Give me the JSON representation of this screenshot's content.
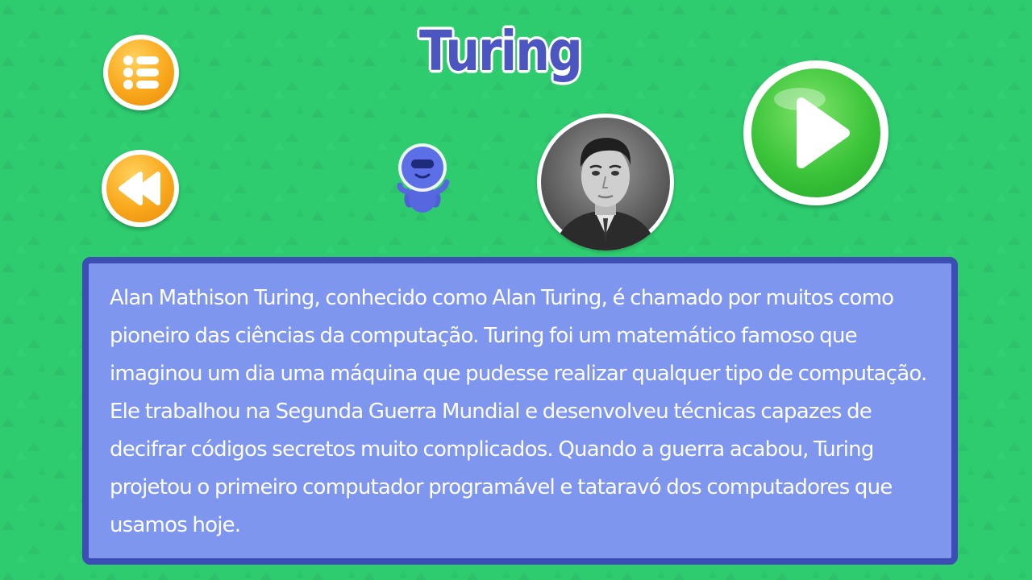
{
  "page": {
    "title": "Turing",
    "colors": {
      "background": "#2ecc6f",
      "panel_fill": "#7f96ef",
      "panel_border": "#3c4db3",
      "title": "#4c56c0",
      "orange_button": "#f9a81c",
      "green_button": "#3bc43a"
    }
  },
  "controls": {
    "menu_icon": "list-icon",
    "back_icon": "rewind-icon",
    "play_icon": "play-icon"
  },
  "character": {
    "icon": "astronaut-mascot-icon"
  },
  "portrait": {
    "icon": "person-portrait-icon"
  },
  "info": {
    "text": "Alan Mathison Turing, conhecido como Alan Turing, é chamado por muitos como pioneiro das ciências da computação. Turing foi um matemático famoso que imaginou um dia uma máquina que pudesse realizar qualquer tipo de computação. Ele trabalhou na Segunda Guerra Mundial e desenvolveu técnicas capazes de decifrar códigos secretos muito complicados. Quando a guerra acabou, Turing projetou o primeiro computador programável e tataravó dos computadores que usamos hoje."
  }
}
